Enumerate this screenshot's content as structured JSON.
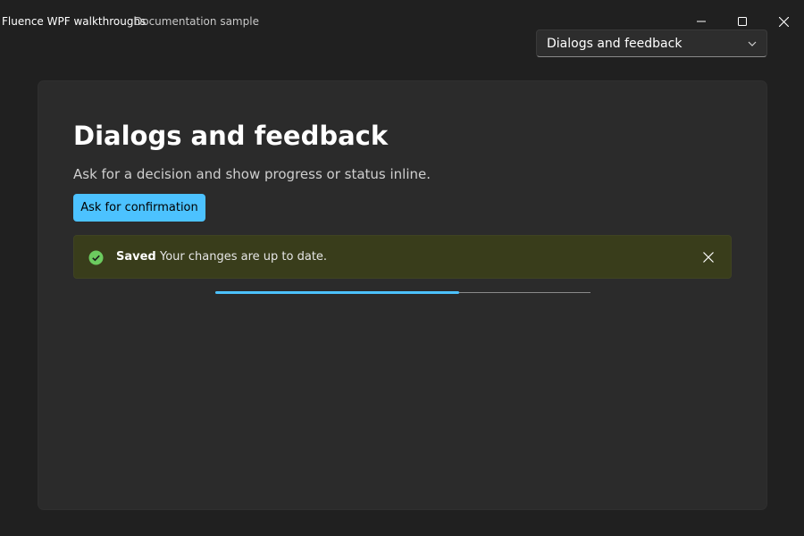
{
  "window": {
    "title": "Fluence WPF walkthroughs",
    "subtitle": "Documentation sample",
    "controls": [
      "minimize-icon",
      "maximize-icon",
      "close-icon"
    ]
  },
  "navigation": {
    "selected": "Dialogs and feedback",
    "icon": "chevron-down-icon"
  },
  "page": {
    "title": "Dialogs and feedback",
    "description": "Ask for a decision and show progress or status inline.",
    "primary_button": "Ask for confirmation"
  },
  "infobar": {
    "title": "Saved",
    "message": "Your changes are up to date.",
    "icon": "check-circle-icon",
    "close_icon": "close-icon",
    "color": "#393d1b",
    "icon_color": "#6ccb5f"
  },
  "progress": {
    "value": 65
  },
  "colors": {
    "accent": "#4cc2ff",
    "background": "#202020",
    "card": "#2b2b2b"
  }
}
